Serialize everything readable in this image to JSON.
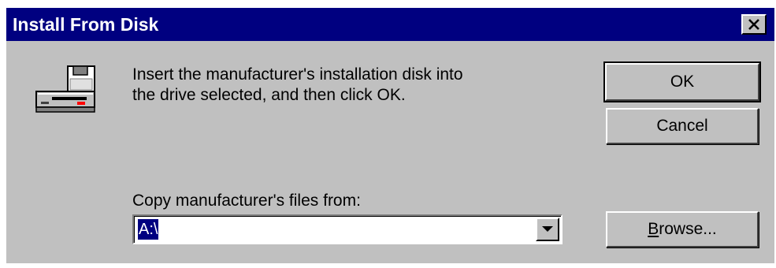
{
  "window": {
    "title": "Install From Disk",
    "close_icon": "close-x-icon"
  },
  "icon": {
    "name": "disk-drive-icon"
  },
  "message": {
    "line1": "Insert the manufacturer's installation disk into",
    "line2": "the drive selected, and then click OK."
  },
  "buttons": {
    "ok_label": "OK",
    "cancel_label": "Cancel",
    "browse_prefix": "B",
    "browse_rest": "rowse..."
  },
  "copy_from": {
    "label": "Copy manufacturer's files from:",
    "value": "A:\\",
    "dropdown_icon": "chevron-down-icon"
  },
  "colors": {
    "title_bar": "#000080",
    "dialog_face": "#c0c0c0",
    "selection": "#000080"
  }
}
